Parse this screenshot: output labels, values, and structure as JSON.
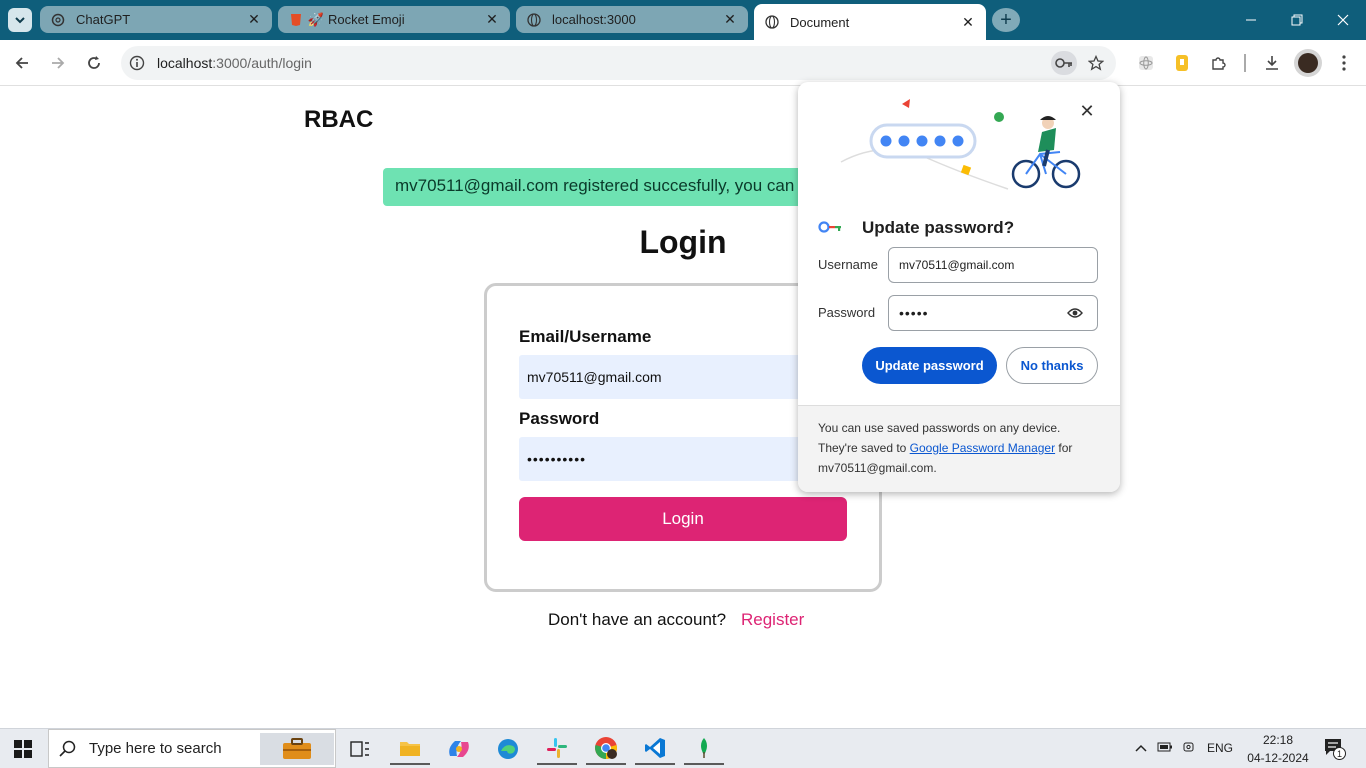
{
  "browser": {
    "tabs": [
      {
        "title": "ChatGPT",
        "icon": "chatgpt-icon"
      },
      {
        "title": "Rocket Emoji",
        "icon": "rocket-icon"
      },
      {
        "title": "localhost:3000",
        "icon": "globe-icon"
      },
      {
        "title": "Document",
        "icon": "globe-icon",
        "active": true
      }
    ],
    "url_host": "localhost",
    "url_path": ":3000/auth/login"
  },
  "page": {
    "brand": "RBAC",
    "flash_message": "mv70511@gmail.com registered succesfully, you can now login",
    "title": "Login",
    "email_label": "Email/Username",
    "email_value": "mv70511@gmail.com",
    "password_label": "Password",
    "password_value": "••••••••••",
    "login_button": "Login",
    "signup_prompt": "Don't have an account?",
    "register_link": "Register"
  },
  "password_popup": {
    "title": "Update password?",
    "username_label": "Username",
    "username_value": "mv70511@gmail.com",
    "password_label": "Password",
    "password_value": "•••••",
    "update_button": "Update password",
    "no_thanks_button": "No thanks",
    "footer_text_1": "You can use saved passwords on any device. They're saved to ",
    "footer_link": "Google Password Manager",
    "footer_text_2": " for mv70511@gmail.com."
  },
  "taskbar": {
    "search_placeholder": "Type here to search",
    "language": "ENG",
    "time": "22:18",
    "date": "04-12-2024",
    "notification_count": "1"
  },
  "colors": {
    "accent": "#dd2474",
    "flash_bg": "#6ee2b2",
    "chrome_frame": "#0f5e7b",
    "google_blue": "#0b57d0"
  }
}
